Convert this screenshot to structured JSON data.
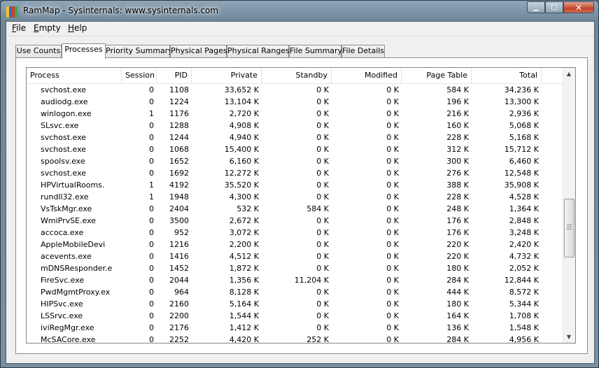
{
  "window": {
    "title": "RamMap - Sysinternals: www.sysinternals.com",
    "icon_colors": [
      "#f7c21b",
      "#2a6ad7",
      "#d43c2b",
      "#3aa83f"
    ],
    "minimize_glyph": "▁",
    "maximize_glyph": "□",
    "close_glyph": "✕"
  },
  "menu": [
    {
      "accel": "F",
      "rest": "ile"
    },
    {
      "accel": "E",
      "rest": "mpty"
    },
    {
      "accel": "H",
      "rest": "elp"
    }
  ],
  "tabs": [
    "Use Counts",
    "Processes",
    "Priority Summary",
    "Physical Pages",
    "Physical Ranges",
    "File Summary",
    "File Details"
  ],
  "active_tab": "Processes",
  "columns": [
    "Process",
    "Session",
    "PID",
    "Private",
    "Standby",
    "Modified",
    "Page Table",
    "Total"
  ],
  "rows": [
    [
      "svchost.exe",
      "0",
      "1108",
      "33,652 K",
      "0 K",
      "0 K",
      "584 K",
      "34,236 K"
    ],
    [
      "audiodg.exe",
      "0",
      "1224",
      "13,104 K",
      "0 K",
      "0 K",
      "196 K",
      "13,300 K"
    ],
    [
      "winlogon.exe",
      "1",
      "1176",
      "2,720 K",
      "0 K",
      "0 K",
      "216 K",
      "2,936 K"
    ],
    [
      "SLsvc.exe",
      "0",
      "1288",
      "4,908 K",
      "0 K",
      "0 K",
      "160 K",
      "5,068 K"
    ],
    [
      "svchost.exe",
      "0",
      "1244",
      "4,940 K",
      "0 K",
      "0 K",
      "228 K",
      "5,168 K"
    ],
    [
      "svchost.exe",
      "0",
      "1068",
      "15,400 K",
      "0 K",
      "0 K",
      "312 K",
      "15,712 K"
    ],
    [
      "spoolsv.exe",
      "0",
      "1652",
      "6,160 K",
      "0 K",
      "0 K",
      "300 K",
      "6,460 K"
    ],
    [
      "svchost.exe",
      "0",
      "1692",
      "12,272 K",
      "0 K",
      "0 K",
      "276 K",
      "12,548 K"
    ],
    [
      "HPVirtualRooms.",
      "1",
      "4192",
      "35,520 K",
      "0 K",
      "0 K",
      "388 K",
      "35,908 K"
    ],
    [
      "rundll32.exe",
      "1",
      "1948",
      "4,300 K",
      "0 K",
      "0 K",
      "228 K",
      "4,528 K"
    ],
    [
      "VsTskMgr.exe",
      "0",
      "2404",
      "532 K",
      "584 K",
      "0 K",
      "248 K",
      "1,364 K"
    ],
    [
      "WmiPrvSE.exe",
      "0",
      "3500",
      "2,672 K",
      "0 K",
      "0 K",
      "176 K",
      "2,848 K"
    ],
    [
      "accoca.exe",
      "0",
      "952",
      "3,072 K",
      "0 K",
      "0 K",
      "176 K",
      "3,248 K"
    ],
    [
      "AppleMobileDevi",
      "0",
      "1216",
      "2,200 K",
      "0 K",
      "0 K",
      "220 K",
      "2,420 K"
    ],
    [
      "acevents.exe",
      "0",
      "1416",
      "4,512 K",
      "0 K",
      "0 K",
      "220 K",
      "4,732 K"
    ],
    [
      "mDNSResponder.e",
      "0",
      "1452",
      "1,872 K",
      "0 K",
      "0 K",
      "180 K",
      "2,052 K"
    ],
    [
      "FireSvc.exe",
      "0",
      "2044",
      "1,356 K",
      "11,204 K",
      "0 K",
      "284 K",
      "12,844 K"
    ],
    [
      "PwdMgmtProxy.ex",
      "0",
      "964",
      "8,128 K",
      "0 K",
      "0 K",
      "444 K",
      "8,572 K"
    ],
    [
      "HIPSvc.exe",
      "0",
      "2160",
      "5,164 K",
      "0 K",
      "0 K",
      "180 K",
      "5,344 K"
    ],
    [
      "LSSrvc.exe",
      "0",
      "2200",
      "1,544 K",
      "0 K",
      "0 K",
      "164 K",
      "1,708 K"
    ],
    [
      "iviRegMgr.exe",
      "0",
      "2176",
      "1,412 K",
      "0 K",
      "0 K",
      "136 K",
      "1,548 K"
    ],
    [
      "McSACore.exe",
      "0",
      "2252",
      "4,420 K",
      "252 K",
      "0 K",
      "284 K",
      "4,956 K"
    ]
  ],
  "scrollbar": {
    "up_glyph": "▲",
    "down_glyph": "▼"
  }
}
